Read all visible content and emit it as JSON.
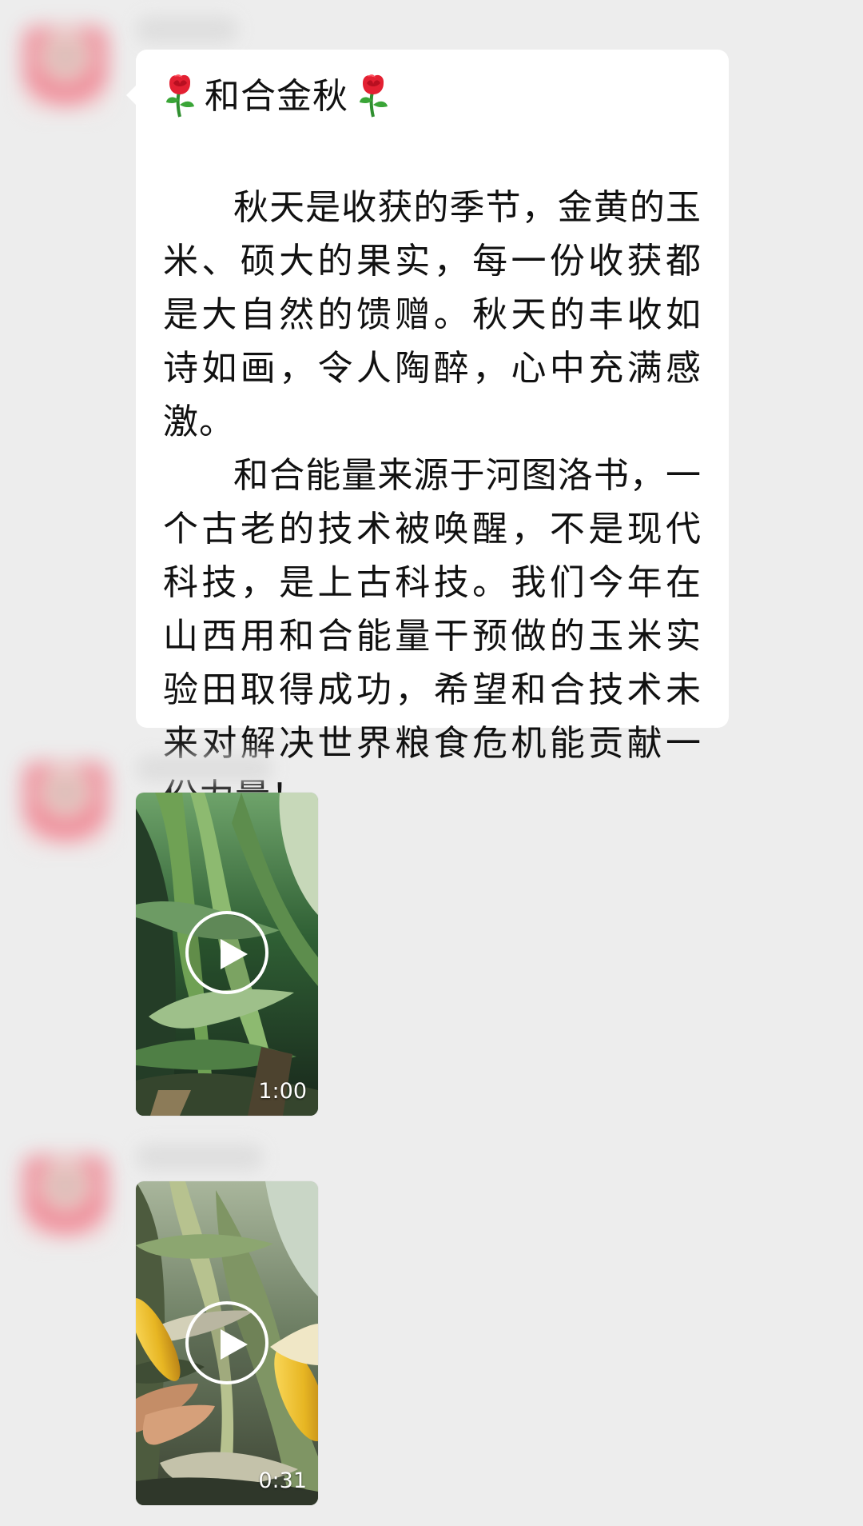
{
  "chat": {
    "messages": [
      {
        "type": "text",
        "title": "和合金秋",
        "paragraphs": [
          "秋天是收获的季节，金黄的玉米、硕大的果实，每一份收获都是大自然的馈赠。秋天的丰收如诗如画，令人陶醉，心中充满感激。",
          "和合能量来源于河图洛书，一个古老的技术被唤醒，不是现代科技，是上古科技。我们今年在山西用和合能量干预做的玉米实验田取得成功，希望和合技术未来对解决世界粮食危机能贡献一份力量！"
        ],
        "decorations": [
          "rose-icon",
          "rose-icon"
        ]
      },
      {
        "type": "video",
        "duration": "1:00",
        "thumbnail": "corn-field-video-thumbnail"
      },
      {
        "type": "video",
        "duration": "0:31",
        "thumbnail": "corn-harvest-video-thumbnail"
      }
    ]
  },
  "colors": {
    "background": "#ededed",
    "bubble": "#ffffff",
    "text": "#111111"
  }
}
